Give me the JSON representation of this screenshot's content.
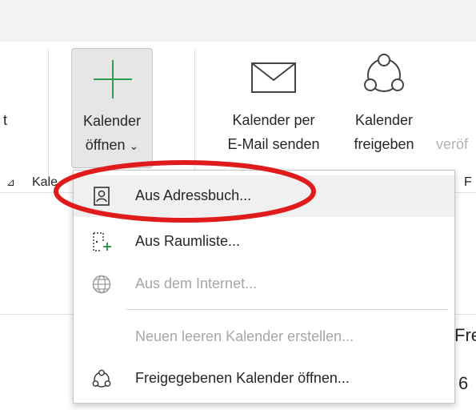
{
  "ribbon": {
    "left_fragment": "t",
    "open_calendar": {
      "line1": "Kalender",
      "line2": "öffnen",
      "chevron": "⌄",
      "icon": "plus-icon"
    },
    "email_calendar": {
      "line1": "Kalender per",
      "line2": "E-Mail senden",
      "icon": "envelope-icon"
    },
    "share_calendar": {
      "line1": "Kalender",
      "line2": "freigeben",
      "icon": "share-icon"
    },
    "publish_fragment": "veröf",
    "group_label_left": "Kale",
    "group_label_right": "F",
    "dialog_launcher": "⊿"
  },
  "background": {
    "text_fre": "Fre",
    "text_6": "6"
  },
  "menu": {
    "items": [
      {
        "label": "Aus Adressbuch...",
        "icon": "address-book-icon",
        "enabled": true,
        "highlighted": true
      },
      {
        "label": "Aus Raumliste...",
        "icon": "room-list-icon",
        "enabled": true,
        "highlighted": false
      },
      {
        "label": "Aus dem Internet...",
        "icon": "globe-icon",
        "enabled": false,
        "highlighted": false
      },
      {
        "label": "Neuen leeren Kalender erstellen...",
        "icon": "",
        "enabled": false,
        "highlighted": false
      },
      {
        "label": "Freigegebenen Kalender öffnen...",
        "icon": "shared-calendar-icon",
        "enabled": true,
        "highlighted": false
      }
    ]
  },
  "colors": {
    "annotation_red": "#e01b1b",
    "plus_green": "#2e9b4e",
    "room_plus_green": "#1e8e3e"
  }
}
